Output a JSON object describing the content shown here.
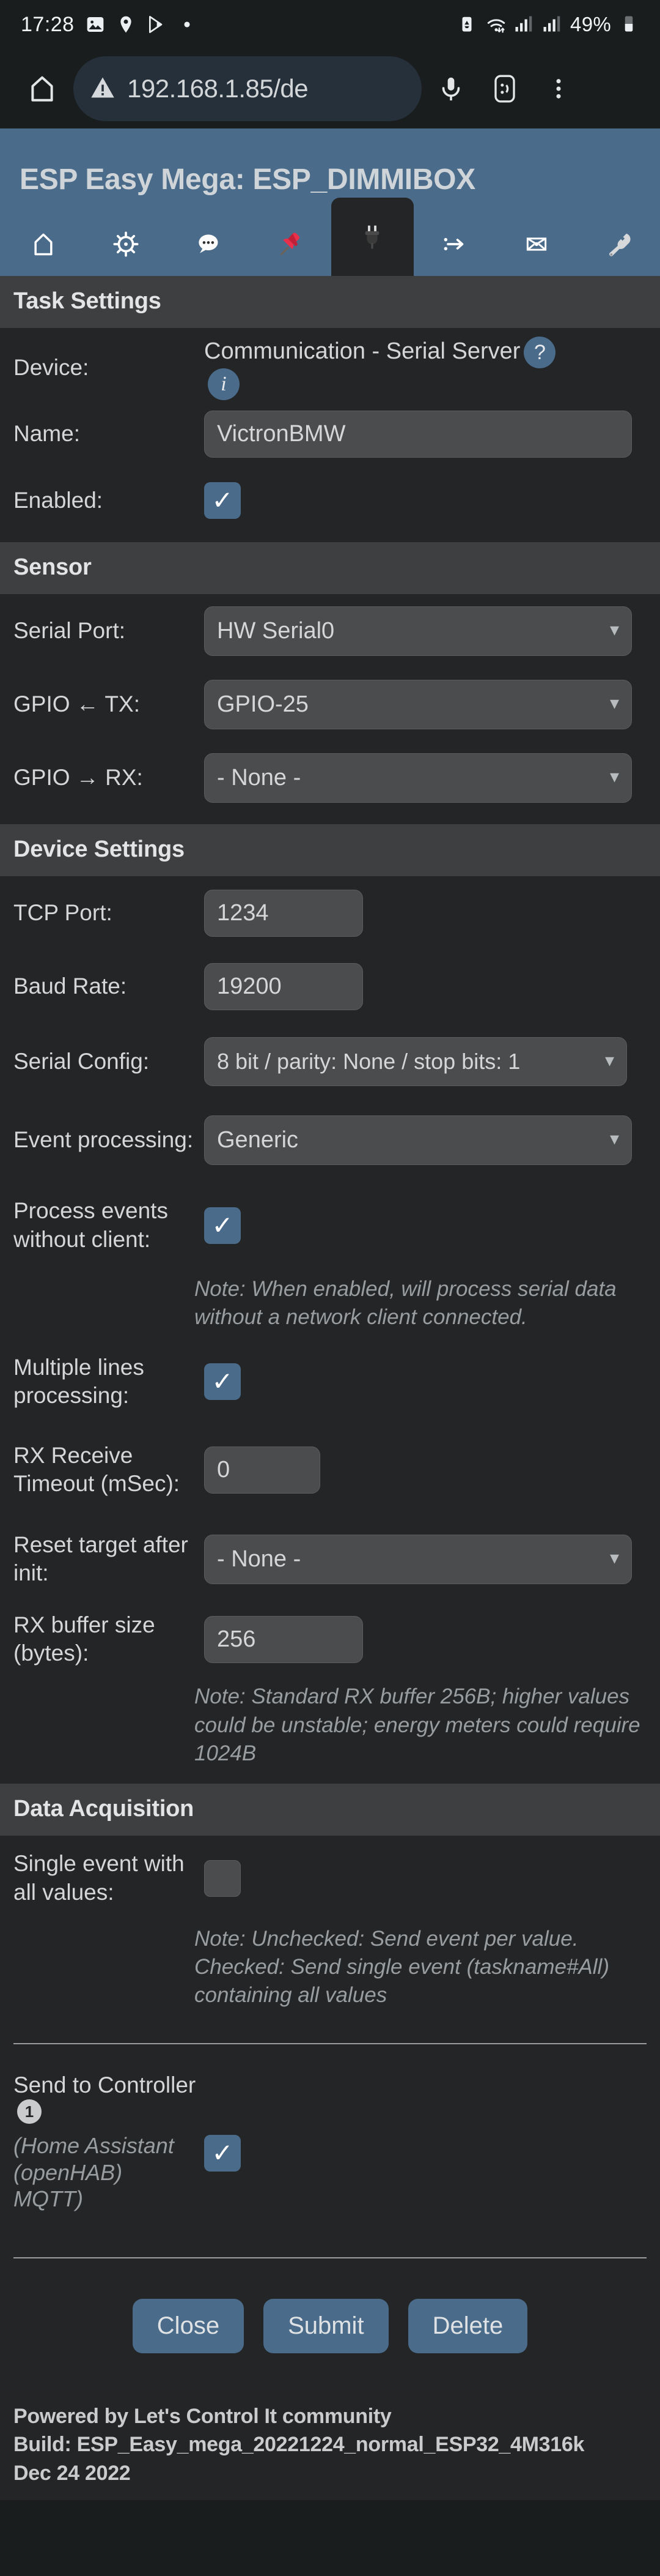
{
  "status_bar": {
    "clock": "17:28",
    "left_icons": [
      "image-icon",
      "location-pin-icon",
      "play-store-icon",
      "dot-icon"
    ],
    "right_icons": [
      "battery-saver-icon",
      "wifi-icon",
      "signal-sim1-icon",
      "signal-sim2-icon"
    ],
    "battery_percent": "49%"
  },
  "browser": {
    "home_icon": "home-icon",
    "security_icon": "not-secure-warning-icon",
    "url": "192.168.1.85/de",
    "mic_icon": "microphone-icon",
    "tab_count_icon": ":D",
    "menu_icon": "overflow-menu-icon"
  },
  "app": {
    "title": "ESP Easy Mega: ESP_DIMMIBOX",
    "header_bg": "#4a6b8a",
    "nav": [
      {
        "name": "nav-home",
        "icon": "⌂",
        "active": false
      },
      {
        "name": "nav-config",
        "icon": "gear",
        "active": false
      },
      {
        "name": "nav-controllers",
        "icon": "💬",
        "active": false
      },
      {
        "name": "nav-hardware",
        "icon": "📌",
        "active": false
      },
      {
        "name": "nav-devices",
        "icon": "🔌",
        "active": true
      },
      {
        "name": "nav-rules",
        "icon": "arrow",
        "active": false
      },
      {
        "name": "nav-notifications",
        "icon": "envelope",
        "active": false
      },
      {
        "name": "nav-tools",
        "icon": "🔧",
        "active": false
      }
    ]
  },
  "sections": {
    "task_settings": {
      "heading": "Task Settings",
      "device_label": "Device:",
      "device_value": "Communication - Serial Server",
      "device_help_badge": "?",
      "device_info_badge": "i",
      "name_label": "Name:",
      "name_value": "VictronBMW",
      "enabled_label": "Enabled:",
      "enabled_checked": true
    },
    "sensor": {
      "heading": "Sensor",
      "serial_port_label": "Serial Port:",
      "serial_port_value": "HW Serial0",
      "gpio_tx_label": "GPIO ← TX:",
      "gpio_tx_value": "GPIO-25",
      "gpio_rx_label": "GPIO → RX:",
      "gpio_rx_value": "- None -"
    },
    "device_settings": {
      "heading": "Device Settings",
      "tcp_port_label": "TCP Port:",
      "tcp_port_value": "1234",
      "baud_rate_label": "Baud Rate:",
      "baud_rate_value": "19200",
      "serial_config_label": "Serial Config:",
      "serial_config_value": "8 bit / parity: None / stop bits: 1",
      "event_processing_label": "Event processing:",
      "event_processing_value": "Generic",
      "process_events_label": "Process events without client:",
      "process_events_checked": true,
      "process_events_note": "Note: When enabled, will process serial data without a network client connected.",
      "multiple_lines_label": "Multiple lines processing:",
      "multiple_lines_checked": true,
      "rx_timeout_label": "RX Receive Timeout (mSec):",
      "rx_timeout_value": "0",
      "reset_target_label": "Reset target after init:",
      "reset_target_value": "- None -",
      "rx_buffer_label": "RX buffer size (bytes):",
      "rx_buffer_value": "256",
      "rx_buffer_note": "Note: Standard RX buffer 256B; higher values could be unstable; energy meters could require 1024B"
    },
    "data_acquisition": {
      "heading": "Data Acquisition",
      "single_event_label": "Single event with all values:",
      "single_event_checked": false,
      "single_event_note": "Note: Unchecked: Send event per value. Checked: Send single event (taskname#All) containing all values",
      "send_to_controller_label": "Send to Controller",
      "send_to_controller_index": "1",
      "send_to_controller_sub": "(Home Assistant (openHAB) MQTT)",
      "send_to_controller_checked": true
    }
  },
  "buttons": {
    "close": "Close",
    "submit": "Submit",
    "delete": "Delete"
  },
  "footer": {
    "line1": "Powered by Let's Control It community",
    "line2": "Build: ESP_Easy_mega_20221224_normal_ESP32_4M316k",
    "line3": "Dec 24 2022"
  }
}
